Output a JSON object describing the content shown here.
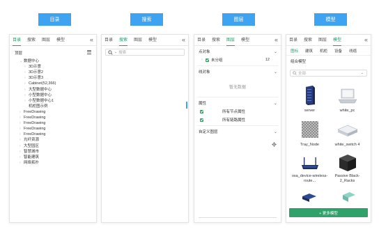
{
  "headers": [
    "目录",
    "搜索",
    "图层",
    "模型"
  ],
  "panel1": {
    "tabs": [
      "目录",
      "搜索",
      "图层",
      "模型"
    ],
    "active_tab": "目录",
    "collapse_glyph": "«",
    "top_label": "顶层",
    "tree": [
      {
        "label": "数据中心",
        "level": 1,
        "expanded": true
      },
      {
        "label": "3D示意",
        "level": 2
      },
      {
        "label": "3D示意2",
        "level": 2
      },
      {
        "label": "3D示意3",
        "level": 2
      },
      {
        "label": "Cabinet(52,366)",
        "level": 2
      },
      {
        "label": "大型数据中心",
        "level": 2
      },
      {
        "label": "小型数据中心",
        "level": 2
      },
      {
        "label": "小型数据中心1",
        "level": 2
      },
      {
        "label": "机柜图示例",
        "level": 2,
        "leaf": true
      },
      {
        "label": "FreeDrawing",
        "level": 1
      },
      {
        "label": "FreeDrawing",
        "level": 1
      },
      {
        "label": "FreeDrawing",
        "level": 1
      },
      {
        "label": "FreeDrawing",
        "level": 1
      },
      {
        "label": "FreeDrawing",
        "level": 1
      },
      {
        "label": "光纤资源",
        "level": 1
      },
      {
        "label": "大型园区",
        "level": 1
      },
      {
        "label": "智慧城市",
        "level": 1
      },
      {
        "label": "智能建筑",
        "level": 1
      },
      {
        "label": "网络拓扑",
        "level": 1
      }
    ]
  },
  "panel2": {
    "tabs": [
      "目录",
      "搜索",
      "图层",
      "模型"
    ],
    "active_tab": "搜索",
    "collapse_glyph": "«",
    "search_placeholder": "搜索"
  },
  "panel3": {
    "tabs": [
      "目录",
      "搜索",
      "图层",
      "模型"
    ],
    "active_tab": "图层",
    "collapse_glyph": "«",
    "sections": {
      "point_objects": "点对象",
      "ungrouped": "未分组",
      "ungrouped_count": "12",
      "line_objects": "线对象",
      "no_data": "暂无数据",
      "properties": "属性",
      "all_node_props": "所有节点属性",
      "all_link_props": "所有链路属性",
      "custom_layers": "自定义图层"
    }
  },
  "panel4": {
    "tabs": [
      "目录",
      "搜索",
      "图层",
      "模型"
    ],
    "active_tab": "模型",
    "collapse_glyph": "«",
    "categories": [
      "图标",
      "建筑",
      "机柜",
      "设备",
      "线缆"
    ],
    "active_category": "图标",
    "group_label": "组合模型",
    "search_placeholder": "全部",
    "models": [
      {
        "label": "server",
        "icon": "server-rack-icon"
      },
      {
        "label": "white_pc",
        "icon": "laptop-icon"
      },
      {
        "label": "Tray_Node",
        "icon": "tray-node-icon"
      },
      {
        "label": "white_switch 4",
        "icon": "switch-icon"
      },
      {
        "label": "osa_device-wireless-route...",
        "icon": "wireless-router-icon"
      },
      {
        "label": "Passive Black-2_Racks",
        "icon": "passive-rack-icon"
      }
    ],
    "more_button": "+ 更多模型"
  }
}
